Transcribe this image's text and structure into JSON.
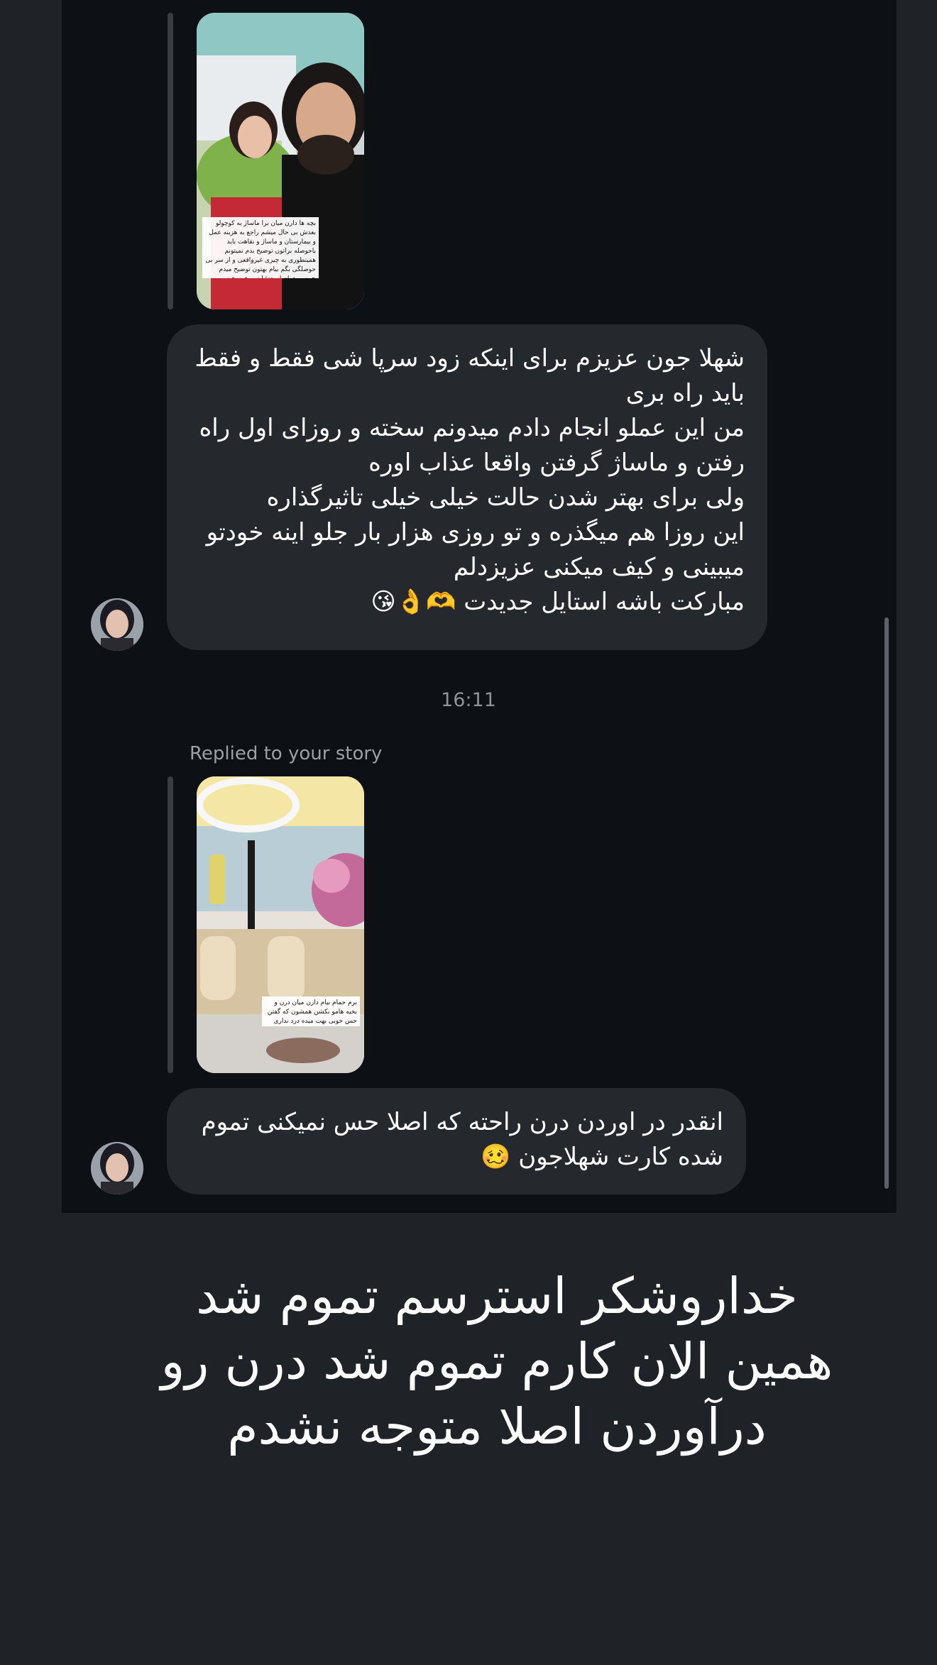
{
  "conversation": {
    "story1": {
      "caption": "بچه ها دارن میان برا ماساژ به کوچولو بعدش بی حال میشم راجع به هزینه عمل و بیمارستان و ماساژ و نقاهت باید باحوصله براتون توضیح بدم نمیتونم همینطوری به چیزی غیرواقعی و از سر بی حوصلگی بگم بیام بهتون توضیح میدم چون میخوام از جزئیات و همه چیز رو به واقعیت بدونید کسایی که میخوان انجام بدن با خیال راحت این کارو انجام بدن❤️"
    },
    "message1": {
      "lines": [
        "شهلا جون عزیزم برای اینکه زود سرپا شی فقط و فقط باید راه بری",
        "من این عملو انجام دادم میدونم سخته و روزای اول راه رفتن و ماساژ گرفتن واقعا عذاب اوره",
        "ولی برای بهتر شدن حالت خیلی خیلی تاثیرگذاره",
        "این روزا هم میگذره و تو روزی هزار بار جلو اینه خودتو میبینی و کیف میکنی عزیزدلم",
        "مبارکت باشه استایل جدیدت 🫶👌😘"
      ]
    },
    "timestamp": "16:11",
    "replied_label": "Replied to your story",
    "story2": {
      "caption": "برم حمام بیام دارن میان درن و بخیه هامو بکشن همشون که گفتن حس خوبی بهت میده درد نداری امیدوارم🤞🏻"
    },
    "message2": {
      "lines": [
        "انقدر در اوردن درن راحته که اصلا حس نمیکنی تموم شده کارت شهلاجون 🥴"
      ]
    },
    "bottom_caption": "خداروشکر استرسم تموم شد همین الان کارم تموم شد درن رو درآوردن اصلا متوجه نشدم"
  },
  "colors": {
    "panel_background": "#0d1014",
    "page_background": "#1f2226",
    "bubble": "#25282d",
    "muted_text": "#8e939a"
  }
}
